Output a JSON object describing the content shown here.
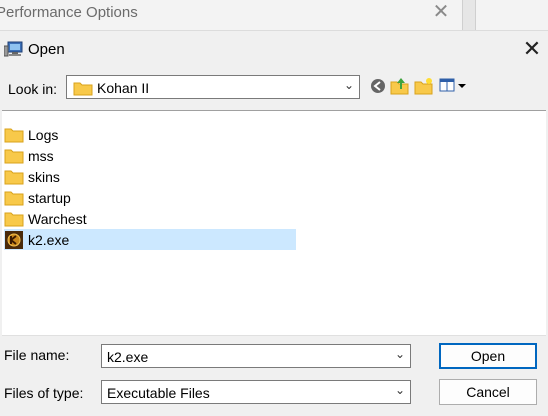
{
  "background_window": {
    "title": "Performance Options",
    "close_glyph": "✕"
  },
  "dialog": {
    "title": "Open",
    "close_glyph": "✕",
    "look_in_label": "Look in:",
    "look_in_value": "Kohan II",
    "toolbar": {
      "back_icon": "back-arrow-icon",
      "up_icon": "up-folder-icon",
      "new_folder_icon": "new-folder-icon",
      "view_icon": "view-menu-icon"
    },
    "items": [
      {
        "name": "Logs",
        "type": "folder"
      },
      {
        "name": "mss",
        "type": "folder"
      },
      {
        "name": "skins",
        "type": "folder"
      },
      {
        "name": "startup",
        "type": "folder"
      },
      {
        "name": "Warchest",
        "type": "folder"
      },
      {
        "name": "k2.exe",
        "type": "exe",
        "selected": true
      }
    ],
    "file_name_label": "File name:",
    "file_name_value": "k2.exe",
    "files_of_type_label": "Files of type:",
    "files_of_type_value": "Executable Files",
    "open_button": "Open",
    "cancel_button": "Cancel"
  },
  "colors": {
    "selection": "#cce8ff",
    "default_button_border": "#0067c0",
    "folder_yellow": "#f8c94a"
  }
}
